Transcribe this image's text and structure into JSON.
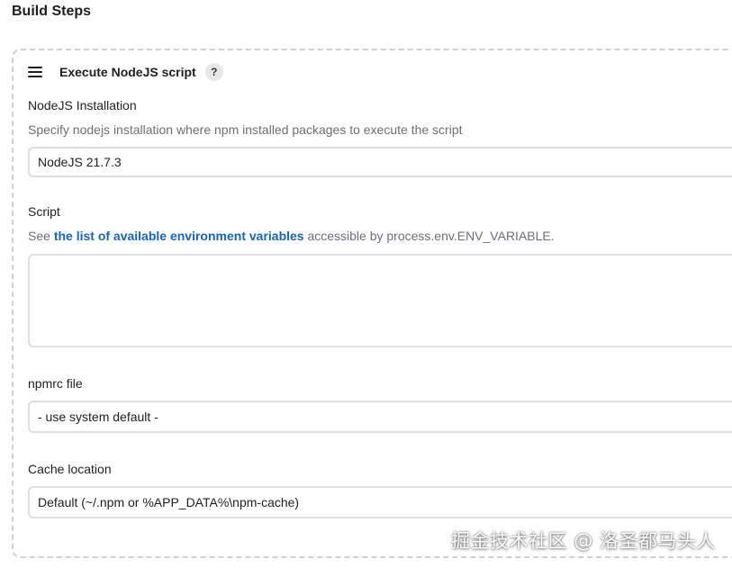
{
  "section": {
    "title": "Build Steps"
  },
  "step": {
    "title": "Execute NodeJS script",
    "help_icon": "?",
    "drag_icon": "hamburger-icon"
  },
  "fields": {
    "nodejs_installation": {
      "label": "NodeJS Installation",
      "description": "Specify nodejs installation where npm installed packages to execute the script",
      "value": "NodeJS 21.7.3"
    },
    "script": {
      "label": "Script",
      "desc_prefix": "See ",
      "desc_link": "the list of available environment variables",
      "desc_suffix": " accessible by process.env.ENV_VARIABLE.",
      "value": ""
    },
    "npmrc_file": {
      "label": "npmrc file",
      "value": "- use system default -"
    },
    "cache_location": {
      "label": "Cache location",
      "value": "Default (~/.npm or %APP_DATA%\\npm-cache)"
    }
  },
  "watermark": "掘金技术社区 @ 洛圣都马头人",
  "colors": {
    "link": "#1565c0",
    "border": "#dedee3",
    "dashed_border": "#cfcfd4",
    "muted_text": "#6e6e78"
  }
}
